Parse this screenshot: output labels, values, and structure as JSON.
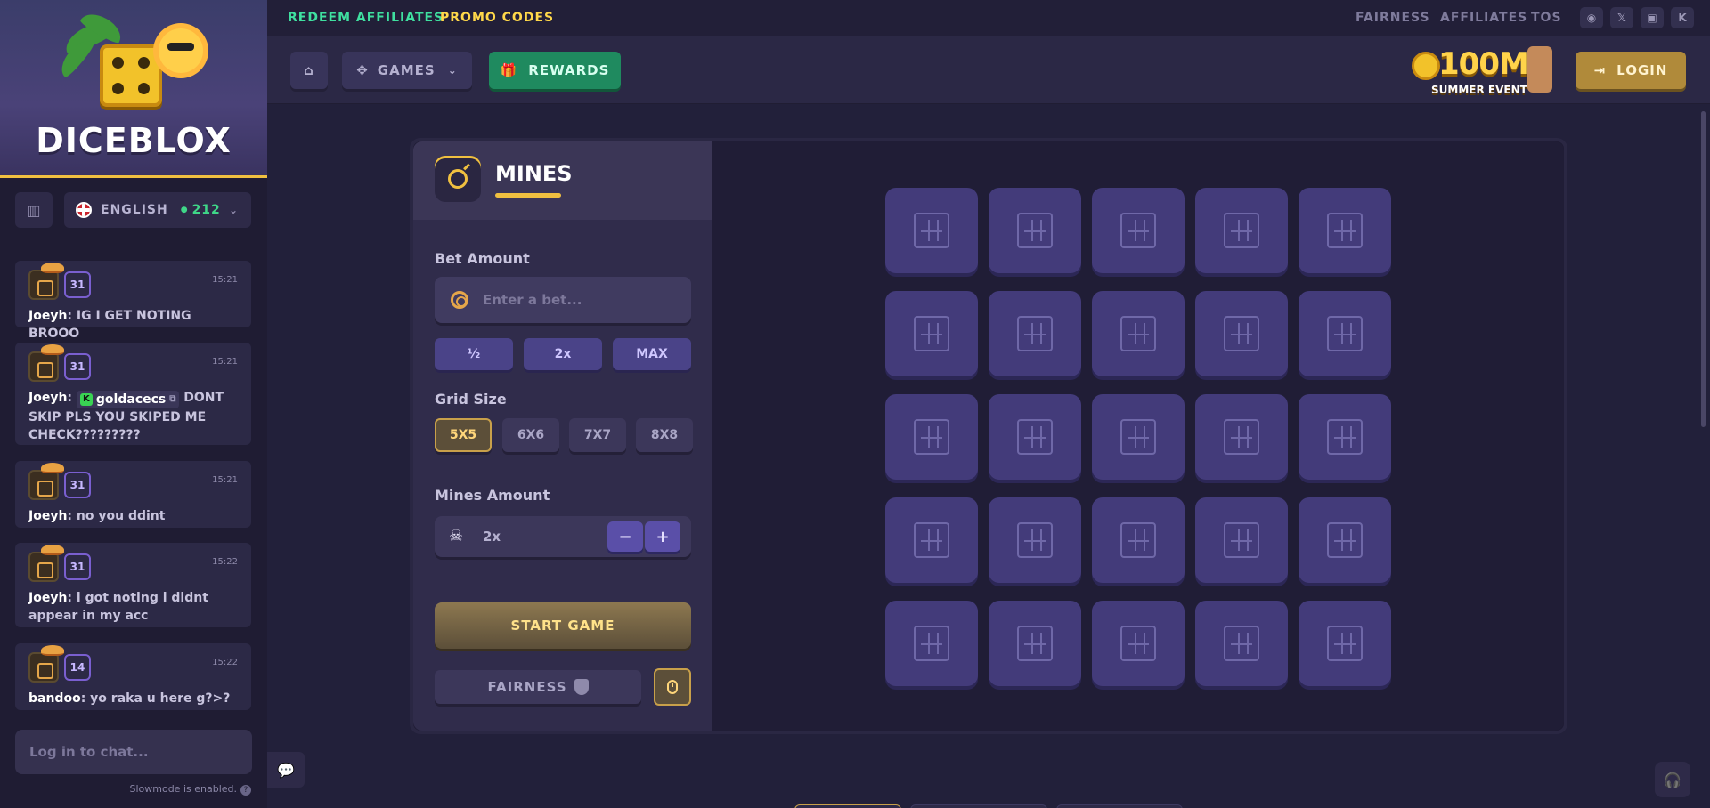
{
  "sidebar": {
    "brand": "DICEBLOX",
    "language": "ENGLISH",
    "online_count": "212",
    "messages": [
      {
        "level": "31",
        "time": "15:21",
        "user": "Joeyh",
        "text": ": IG I GET NOTING BROOO"
      },
      {
        "level": "31",
        "time": "15:21",
        "user": "Joeyh",
        "mention": "goldacecs",
        "text": " DONT SKIP PLS YOU SKIPED ME CHECK?????????"
      },
      {
        "level": "31",
        "time": "15:21",
        "user": "Joeyh",
        "text": ": no you ddint"
      },
      {
        "level": "31",
        "time": "15:22",
        "user": "Joeyh",
        "text": ": i got noting i didnt appear in my acc"
      },
      {
        "level": "14",
        "time": "15:22",
        "user": "bandoo",
        "text": ": yo raka u here g?>?"
      }
    ],
    "chat_placeholder": "Log in to chat...",
    "slowmode": "Slowmode is enabled."
  },
  "topnav": {
    "redeem_affiliates": "REDEEM AFFILIATES",
    "promo_codes": "PROMO CODES",
    "fairness": "FAIRNESS",
    "affiliates": "AFFILIATES",
    "tos": "TOS",
    "socials": [
      "discord-icon",
      "x-icon",
      "twitch-icon",
      "kick-icon"
    ]
  },
  "mainbar": {
    "games": "GAMES",
    "rewards": "REWARDS",
    "event_big": "100M",
    "event_small": "SUMMER EVENT",
    "login": "LOGIN"
  },
  "game": {
    "title": "MINES",
    "bet_label": "Bet Amount",
    "bet_placeholder": "Enter a bet...",
    "multipliers": [
      "½",
      "2x",
      "MAX"
    ],
    "grid_label": "Grid Size",
    "grid_sizes": [
      "5X5",
      "6X6",
      "7X7",
      "8X8"
    ],
    "grid_selected": "5X5",
    "mines_label": "Mines Amount",
    "mines_value": "2x",
    "start": "START GAME",
    "fairness": "FAIRNESS",
    "board_rows": 5,
    "board_cols": 5
  },
  "colors": {
    "accent_gold": "#f0c040",
    "rewards_green": "#1f8a5f",
    "redeem_green": "#3fe0a0",
    "promo_yellow": "#ffd84a",
    "tile": "#433b7a"
  }
}
